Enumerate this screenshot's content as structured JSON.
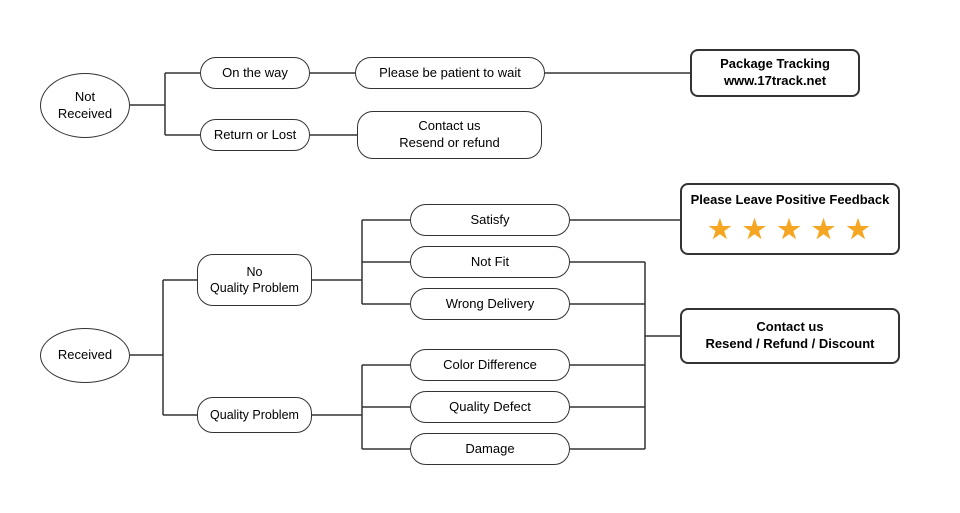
{
  "nodes": {
    "not_received": {
      "label": "Not\nReceived"
    },
    "on_the_way": {
      "label": "On the way"
    },
    "please_be_patient": {
      "label": "Please be patient to wait"
    },
    "package_tracking": {
      "label": "Package Tracking\nwww.17track.net"
    },
    "return_or_lost": {
      "label": "Return or Lost"
    },
    "contact_us_1": {
      "label": "Contact us\nResend or refund"
    },
    "received": {
      "label": "Received"
    },
    "no_quality_problem": {
      "label": "No\nQuality Problem"
    },
    "satisfy": {
      "label": "Satisfy"
    },
    "not_fit": {
      "label": "Not Fit"
    },
    "wrong_delivery": {
      "label": "Wrong Delivery"
    },
    "quality_problem": {
      "label": "Quality Problem"
    },
    "color_difference": {
      "label": "Color Difference"
    },
    "quality_defect": {
      "label": "Quality Defect"
    },
    "damage": {
      "label": "Damage"
    },
    "please_leave": {
      "label": "Please Leave Positive Feedback"
    },
    "stars": {
      "label": "★ ★ ★ ★ ★"
    },
    "contact_us_2": {
      "label": "Contact us\nResend / Refund / Discount"
    }
  }
}
